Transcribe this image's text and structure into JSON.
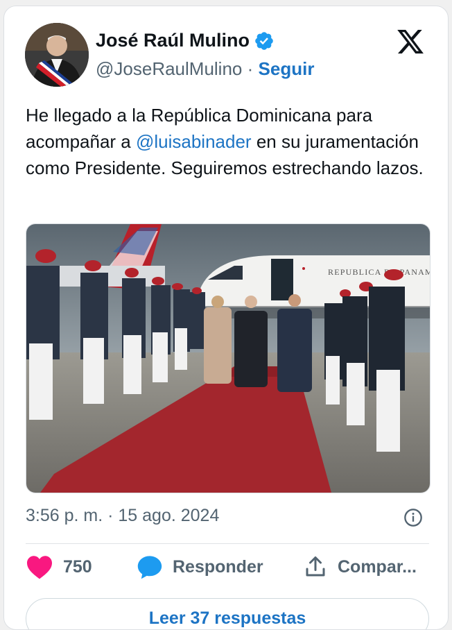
{
  "tweet": {
    "author_name": "José Raúl Mulino",
    "handle": "@JoseRaulMulino",
    "separator": "·",
    "follow_label": "Seguir",
    "text_before": "He llegado a la República Dominicana para acompañar a ",
    "mention": "@luisabinader",
    "text_after": " en su juramentación como Presidente. Seguiremos estrechando lazos.",
    "timestamp": "3:56 p. m. · 15 ago. 2024",
    "photo_plane_text": "REPUBLICA DE PANAMA"
  },
  "actions": {
    "like_count": "750",
    "reply_label": "Responder",
    "share_label": "Compar..."
  },
  "replies_button": "Leer 37 respuestas",
  "icons": [
    "verified-badge-icon",
    "x-logo-icon",
    "info-icon",
    "heart-icon",
    "reply-bubble-icon",
    "share-icon"
  ],
  "colors": {
    "accent": "#1d74c4",
    "like": "#f91880",
    "text": "#0f1419",
    "muted": "#536471"
  }
}
